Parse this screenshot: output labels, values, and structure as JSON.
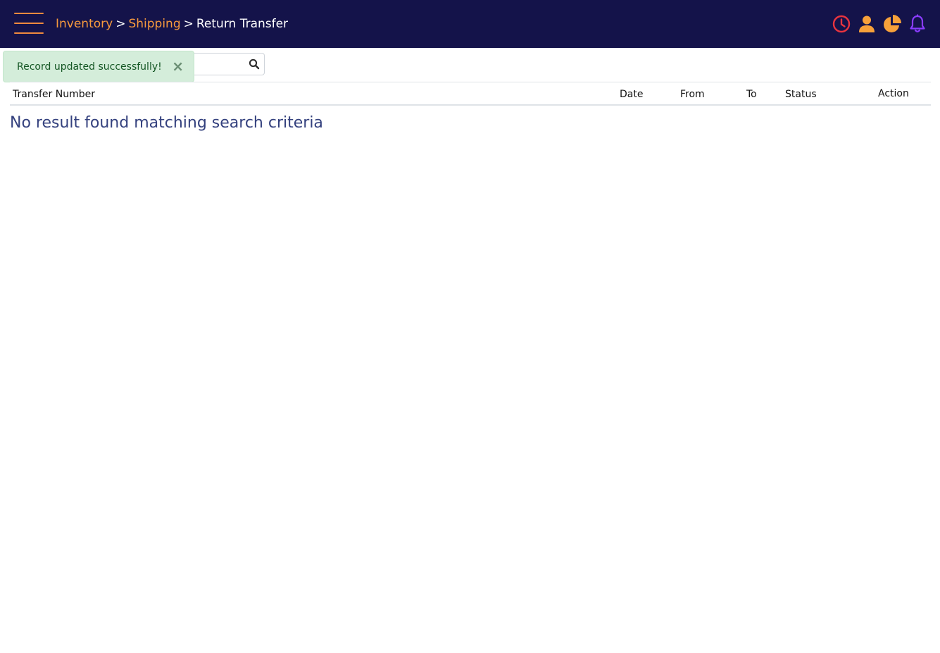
{
  "header": {
    "breadcrumb": {
      "items": [
        {
          "label": "Inventory"
        },
        {
          "label": "Shipping"
        }
      ],
      "separator": ">",
      "current": "Return Transfer"
    },
    "icons": [
      {
        "name": "clock-icon",
        "color": "#e8343f"
      },
      {
        "name": "user-icon",
        "color": "#f7a13a"
      },
      {
        "name": "pie-chart-icon",
        "color": "#f7a13a"
      },
      {
        "name": "bell-icon",
        "color": "#8a3cff"
      }
    ],
    "menu_color": "#f08a3e",
    "background": "#14134a"
  },
  "search": {
    "placeholder": "",
    "value": ""
  },
  "toast": {
    "message": "Record updated successfully!",
    "close_symbol": "×"
  },
  "table": {
    "columns": [
      "Transfer Number",
      "Date",
      "From",
      "To",
      "Status",
      "Action"
    ],
    "rows": [],
    "empty_message": "No result found matching search criteria"
  }
}
